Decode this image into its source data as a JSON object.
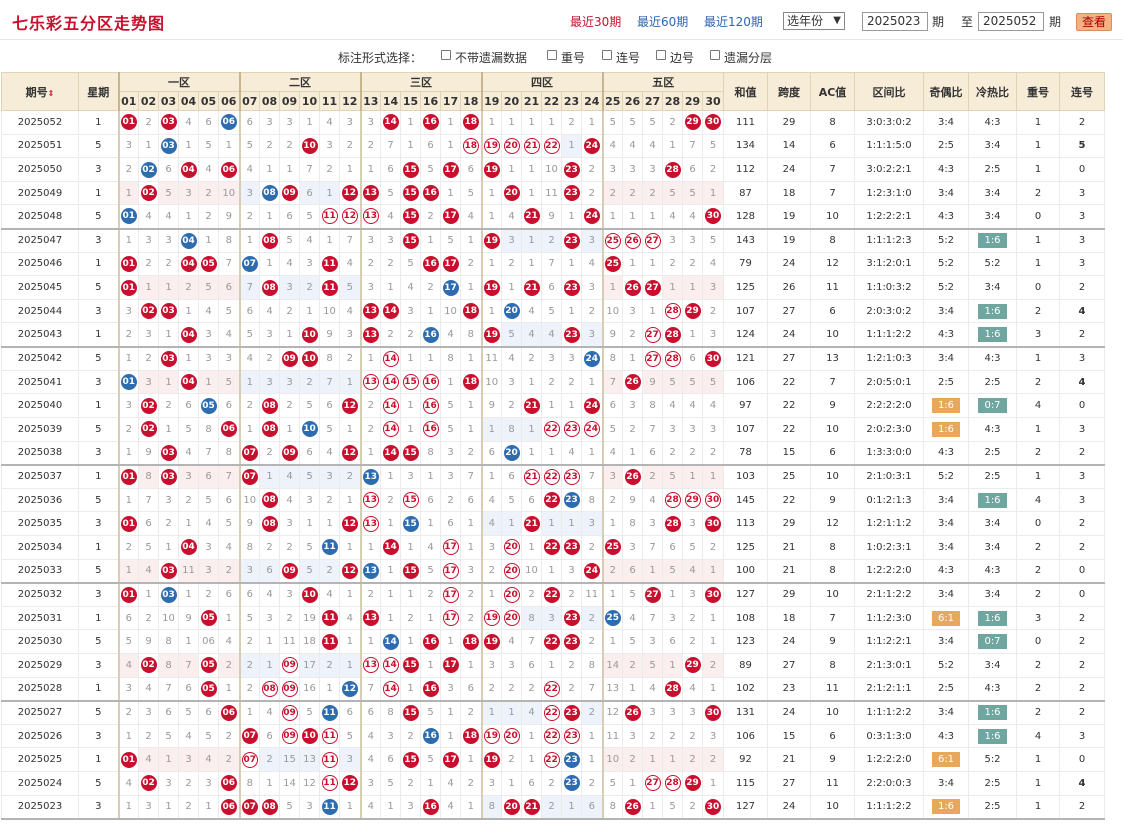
{
  "header": {
    "title": "七乐彩五分区走势图",
    "recent": [
      "最近30期",
      "最近60期",
      "最近120期"
    ],
    "year_select": "选年份",
    "from_label": "期",
    "to_prefix": "至",
    "to_label": "期",
    "from_issue": "2025023",
    "to_issue": "2025052",
    "view_button": "查看"
  },
  "options": {
    "label": "标注形式选择：",
    "items": [
      "不带遗漏数据",
      "重号",
      "连号",
      "边号",
      "遗漏分层"
    ]
  },
  "table": {
    "h_period": "期号",
    "h_week": "星期",
    "zones": [
      "一区",
      "二区",
      "三区",
      "四区",
      "五区"
    ],
    "numbers": [
      "01",
      "02",
      "03",
      "04",
      "05",
      "06",
      "07",
      "08",
      "09",
      "10",
      "11",
      "12",
      "13",
      "14",
      "15",
      "16",
      "17",
      "18",
      "19",
      "20",
      "21",
      "22",
      "23",
      "24",
      "25",
      "26",
      "27",
      "28",
      "29",
      "30"
    ],
    "stats": [
      "和值",
      "跨度",
      "AC值",
      "区间比",
      "奇偶比",
      "冷热比",
      "重号",
      "连号"
    ]
  },
  "colors": {
    "ball_red": "#c8102e",
    "ball_blue": "#2e6cb0",
    "header_bg": "#f6ecd8",
    "badge_orange": "#e8a85c",
    "badge_teal": "#6fa7a0"
  },
  "rows": [
    {
      "p": "2025052",
      "w": "1",
      "d": "01,2,03,4,6,06b,6,3,3,1,4,3,3,14,1,16,1,18,1,1,1,1,2,1,5,5,5,2,29,30",
      "s": [
        "111",
        "29",
        "8",
        "3:0:3:0:2",
        "3:4",
        "4:3",
        "1",
        "2"
      ]
    },
    {
      "p": "2025051",
      "w": "5",
      "d": "3,1,03b,1,5,1,5,2,2,10,3,2,2,7,1,6,1,18r,19r,20r,21r,22r,1,24,4,4,4,1,7,5",
      "s": [
        "134",
        "14",
        "6",
        "1:1:1:5:0",
        "2:5",
        "3:4",
        "1",
        "5"
      ]
    },
    {
      "p": "2025050",
      "w": "3",
      "d": "2,02b,6,04,4,06,4,1,1,7,2,1,1,6,15,5,17,6,19,1,1,10,23,2,3,3,3,28,6,2",
      "s": [
        "112",
        "24",
        "7",
        "3:0:2:2:1",
        "4:3",
        "2:5",
        "1",
        "0"
      ]
    },
    {
      "p": "2025049",
      "w": "1",
      "d": "1,02,5,3,2,10,3,08b,09,6,1,12,13,5,15,16,1,5,1,20,1,11,23,2,2,2,2,5,5,1",
      "s": [
        "87",
        "18",
        "7",
        "1:2:3:1:0",
        "3:4",
        "3:4",
        "2",
        "3"
      ]
    },
    {
      "p": "2025048",
      "w": "5",
      "d": "01b,4,4,1,2,9,2,1,6,5,11r,12r,13r,4,15,2,17,4,1,4,21,9,1,24,1,1,1,4,4,30",
      "s": [
        "128",
        "19",
        "10",
        "1:2:2:2:1",
        "4:3",
        "3:4",
        "0",
        "3"
      ]
    },
    {
      "p": "2025047",
      "w": "3",
      "d": "1,3,3,04b,1,8,1,08,5,4,1,7,3,3,15,1,5,1,19,3,1,2,23,3,25r,26r,27r,3,3,5",
      "s": [
        "143",
        "19",
        "8",
        "1:1:1:2:3",
        "5:2",
        "G1:6",
        "1",
        "3"
      ]
    },
    {
      "p": "2025046",
      "w": "1",
      "d": "01,2,2,04,05,7,07b,1,4,3,11,4,2,2,5,16,17,2,1,2,1,7,1,4,25,1,1,2,2,4",
      "s": [
        "79",
        "24",
        "12",
        "3:1:2:0:1",
        "5:2",
        "5:2",
        "1",
        "3"
      ]
    },
    {
      "p": "2025045",
      "w": "5",
      "d": "01,1,1,2,5,6,7,08,3,2,11,5,3,1,4,2,17b,1,19,1,21,6,23,3,1,26,27,1,1,3",
      "s": [
        "125",
        "26",
        "11",
        "1:1:0:3:2",
        "5:2",
        "3:4",
        "0",
        "2"
      ]
    },
    {
      "p": "2025044",
      "w": "3",
      "d": "3,02,03,1,4,5,6,4,2,1,10,4,13,14,3,1,10,18,1,20b,4,5,1,2,10,3,1,28r,29,2",
      "s": [
        "107",
        "27",
        "6",
        "2:0:3:0:2",
        "3:4",
        "G1:6",
        "2",
        "4"
      ]
    },
    {
      "p": "2025043",
      "w": "1",
      "d": "2,3,1,04,3,4,5,3,1,10,9,3,13,2,2,16b,4,8,19,5,4,4,23,3,9,2,27r,28,1,3",
      "s": [
        "124",
        "24",
        "10",
        "1:1:1:2:2",
        "4:3",
        "G1:6",
        "3",
        "2"
      ]
    },
    {
      "p": "2025042",
      "w": "5",
      "d": "1,2,03,1,3,3,4,2,09,10,8,2,1,14r,1,1,8,1,11,4,2,3,3,24b,8,1,27r,28r,6,30",
      "s": [
        "121",
        "27",
        "13",
        "1:2:1:0:3",
        "3:4",
        "4:3",
        "1",
        "3"
      ]
    },
    {
      "p": "2025041",
      "w": "3",
      "d": "01b,3,1,04,1,5,1,3,3,2,7,1,13r,14r,15r,16r,1,18,10,3,1,2,2,1,7,26,9,5,5,5",
      "s": [
        "106",
        "22",
        "7",
        "2:0:5:0:1",
        "2:5",
        "2:5",
        "2",
        "4"
      ]
    },
    {
      "p": "2025040",
      "w": "1",
      "d": "3,02,2,6,05b,6,2,08,2,5,6,12,2,14r,1,16r,5,1,9,2,21,1,1,24,6,3,8,4,4,4",
      "s": [
        "97",
        "22",
        "9",
        "2:2:2:2:0",
        "O1:6",
        "G0:7",
        "R4",
        "0"
      ]
    },
    {
      "p": "2025039",
      "w": "5",
      "d": "2,02,1,5,8,06,1,08,1,10b,5,1,2,14r,1,16r,5,1,1,8,1,22r,23r,24r,5,2,7,3,3,3",
      "s": [
        "107",
        "22",
        "10",
        "2:0:2:3:0",
        "O1:6",
        "4:3",
        "1",
        "3"
      ]
    },
    {
      "p": "2025038",
      "w": "3",
      "d": "1,9,03,4,7,8,07,2,09,6,4,12,1,14,15,8,3,2,6,20b,1,1,4,1,4,1,6,2,2,2",
      "s": [
        "78",
        "15",
        "6",
        "1:3:3:0:0",
        "4:3",
        "2:5",
        "2",
        "2"
      ]
    },
    {
      "p": "2025037",
      "w": "1",
      "d": "01,8,03,3,6,7,07,1,4,5,3,2,13b,1,3,1,3,7,1,6,21r,22r,23r,7,3,26,2,5,1,1",
      "s": [
        "103",
        "25",
        "10",
        "2:1:0:3:1",
        "5:2",
        "2:5",
        "1",
        "3"
      ]
    },
    {
      "p": "2025036",
      "w": "5",
      "d": "1,7,3,2,5,6,10,08,4,3,2,1,13r,2,15r,6,2,6,4,5,6,22,23b,8,2,9,4,28r,29r,30r",
      "s": [
        "145",
        "22",
        "9",
        "0:1:2:1:3",
        "3:4",
        "G1:6",
        "R4",
        "3"
      ]
    },
    {
      "p": "2025035",
      "w": "3",
      "d": "01,6,2,1,4,5,9,08,3,1,1,12,13r,1,15b,1,6,1,4,1,21,1,1,3,1,8,3,28,3,30",
      "s": [
        "113",
        "29",
        "12",
        "1:2:1:1:2",
        "3:4",
        "3:4",
        "0",
        "2"
      ]
    },
    {
      "p": "2025034",
      "w": "1",
      "d": "2,5,1,04,3,4,8,2,2,5,11b,1,1,14,1,4,17r,1,3,20r,1,22,23,2,25,3,7,6,5,2",
      "s": [
        "125",
        "21",
        "8",
        "1:0:2:3:1",
        "3:4",
        "3:4",
        "2",
        "2"
      ]
    },
    {
      "p": "2025033",
      "w": "5",
      "d": "1,4,03,11,3,2,3,6,09,5,2,12,13b,1,15,5,17r,3,2,20r,10,1,3,24,2,6,1,5,4,1",
      "s": [
        "100",
        "21",
        "8",
        "1:2:2:2:0",
        "4:3",
        "4:3",
        "2",
        "0"
      ]
    },
    {
      "p": "2025032",
      "w": "3",
      "d": "01,1,03b,1,2,6,6,4,3,10,4,1,2,1,1,2,17r,2,1,20r,2,22,2,11,1,5,27,1,3,30",
      "s": [
        "127",
        "29",
        "10",
        "2:1:1:2:2",
        "3:4",
        "3:4",
        "2",
        "0"
      ]
    },
    {
      "p": "2025031",
      "w": "1",
      "d": "6,2,10,9,05,1,5,3,2,19,11,4,13,1,2,1,17r,2,19r,20r,8,3,23,2,25b,4,7,3,2,1",
      "s": [
        "108",
        "18",
        "7",
        "1:1:2:3:0",
        "O6:1",
        "G1:6",
        "3",
        "2"
      ]
    },
    {
      "p": "2025030",
      "w": "5",
      "d": "5,9,8,1,06,4,2,1,11,18,11,1,1,14b,1,16,1,18,19,4,7,22,23,2,1,5,3,6,2,1",
      "s": [
        "123",
        "24",
        "9",
        "1:1:2:2:1",
        "3:4",
        "G0:7",
        "0",
        "2"
      ]
    },
    {
      "p": "2025029",
      "w": "3",
      "d": "4,02,8,7,05,2,2,1,09r,17,2,1,13r,14r,15,1,17,1,3,3,6,1,2,8,14,2,5,1,29,2",
      "s": [
        "89",
        "27",
        "8",
        "2:1:3:0:1",
        "5:2",
        "3:4",
        "2",
        "2"
      ]
    },
    {
      "p": "2025028",
      "w": "1",
      "d": "3,4,7,6,05,1,2,08r,09r,16,1,12b,7,14r,1,16,3,6,2,2,2,22r,2,7,13,1,4,28,4,1",
      "s": [
        "102",
        "23",
        "11",
        "2:1:2:1:1",
        "2:5",
        "4:3",
        "2",
        "2"
      ]
    },
    {
      "p": "2025027",
      "w": "5",
      "d": "2,3,6,5,6,06,1,4,09r,5,11b,6,6,8,15,5,1,2,1,1,4,22r,23,2,12,26,3,3,3,30",
      "s": [
        "131",
        "24",
        "10",
        "1:1:1:2:2",
        "3:4",
        "G1:6",
        "2",
        "2"
      ]
    },
    {
      "p": "2025026",
      "w": "3",
      "d": "1,2,5,4,5,2,07,6,09r,10,11r,5,4,3,2,16b,1,18,19r,20r,1,22r,23r,1,11,3,2,2,2,3",
      "s": [
        "106",
        "15",
        "6",
        "0:3:1:3:0",
        "4:3",
        "G1:6",
        "R4",
        "3"
      ]
    },
    {
      "p": "2025025",
      "w": "1",
      "d": "01,4,1,3,4,2,07r,2,15,13,11r,3,4,6,15,5,17,1,19,2,1,22r,23b,1,10,2,1,1,2,2",
      "s": [
        "92",
        "21",
        "9",
        "1:2:2:2:0",
        "O6:1",
        "5:2",
        "1",
        "0"
      ]
    },
    {
      "p": "2025024",
      "w": "5",
      "d": "4,02,3,2,3,06,8,1,14,12,11r,12,3,5,2,1,4,2,3,1,6,2,23b,2,5,1,27r,28r,29,1",
      "s": [
        "115",
        "27",
        "11",
        "2:2:0:0:3",
        "3:4",
        "2:5",
        "1",
        "4"
      ]
    },
    {
      "p": "2025023",
      "w": "3",
      "d": "1,3,1,2,1,06,07,08,5,3,11b,1,4,1,3,16,4,1,8,20,21,2,1,6,8,26,1,5,2,30",
      "s": [
        "127",
        "24",
        "10",
        "1:1:1:2:2",
        "O1:6",
        "2:5",
        "1",
        "2"
      ]
    }
  ]
}
